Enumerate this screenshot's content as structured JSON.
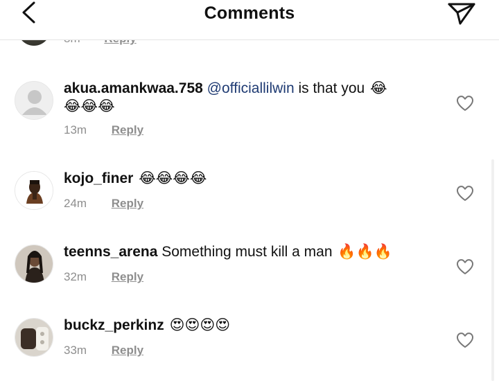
{
  "header": {
    "title": "Comments",
    "back_icon": "chevron-left-icon",
    "share_icon": "paper-plane-icon"
  },
  "previous_comment": {
    "time": "8m",
    "reply_label": "Reply"
  },
  "comments": [
    {
      "username": "akua.amankwaa.758",
      "mention": "@officiallilwin",
      "text": " is that you ",
      "emojis_inline": "😂",
      "emojis_line2": "😂😂😂",
      "time": "13m",
      "reply_label": "Reply"
    },
    {
      "username": "kojo_finer",
      "text": " ",
      "emojis_inline": "😂😂😂😂",
      "time": "24m",
      "reply_label": "Reply"
    },
    {
      "username": "teenns_arena",
      "text": " Something must kill a man ",
      "emojis_inline": "🔥🔥🔥",
      "time": "32m",
      "reply_label": "Reply"
    },
    {
      "username": "buckz_perkinz",
      "text": " ",
      "emojis_inline": "😍😍😍😍",
      "time": "33m",
      "reply_label": "Reply"
    }
  ],
  "colors": {
    "text": "#111111",
    "muted": "#8e8e8e",
    "mention": "#1f3b73",
    "divider": "#e3e3e3"
  }
}
